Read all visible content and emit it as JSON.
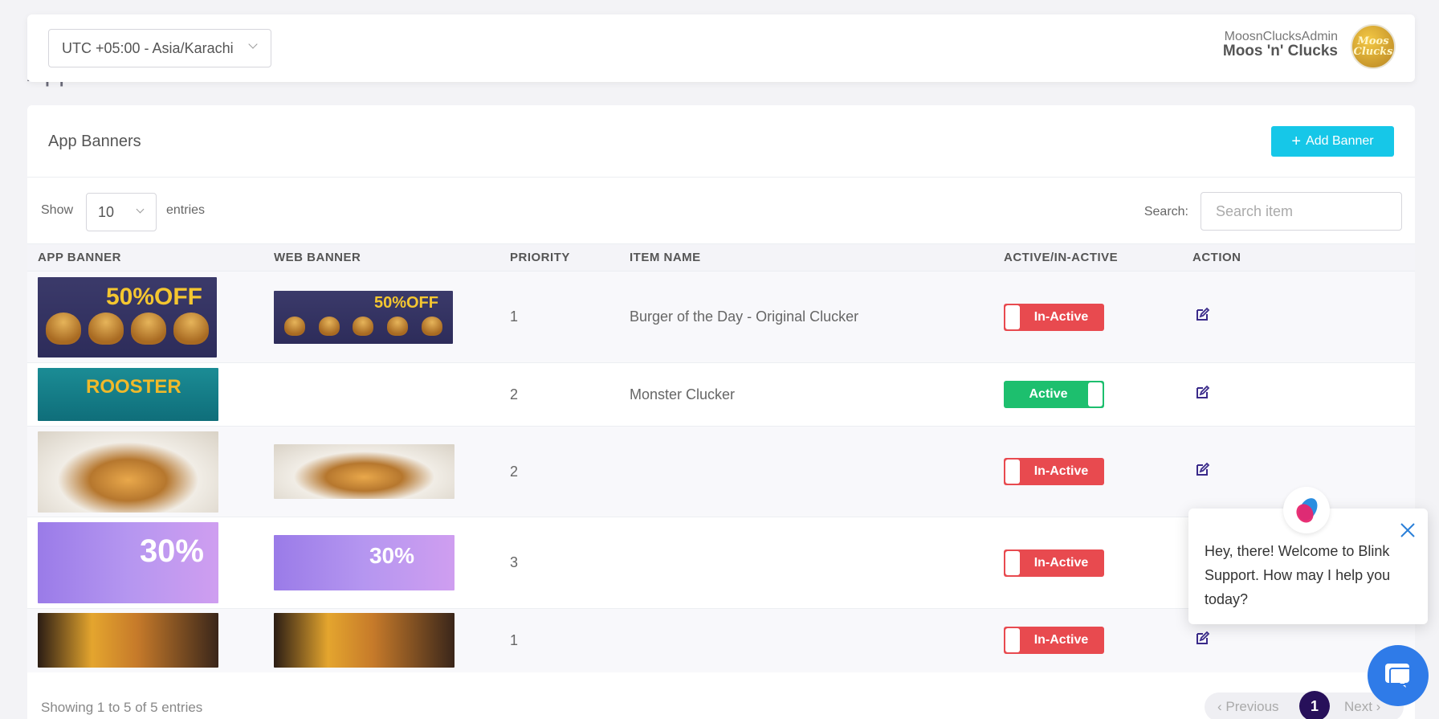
{
  "page": {
    "background_title": "App Banners"
  },
  "topbar": {
    "timezone": "UTC +05:00 - Asia/Karachi",
    "user_id": "MoosnClucksAdmin",
    "user_name": "Moos 'n' Clucks",
    "avatar_text": "Moos Clucks"
  },
  "card": {
    "title": "App Banners",
    "add_button_label": "Add Banner"
  },
  "controls": {
    "show_label": "Show",
    "page_length": "10",
    "entries_label": "entries",
    "search_label": "Search:",
    "search_placeholder": "Search item"
  },
  "table": {
    "columns": [
      "APP BANNER",
      "WEB BANNER",
      "PRIORITY",
      "ITEM NAME",
      "ACTIVE/IN-ACTIVE",
      "ACTION"
    ],
    "rows": [
      {
        "priority": "1",
        "item_name": "Burger of the Day - Original Clucker",
        "status": "In-Active",
        "active": false,
        "app_banner_text": "50%OFF",
        "web_banner_text": "50%OFF"
      },
      {
        "priority": "2",
        "item_name": "Monster Clucker",
        "status": "Active",
        "active": true,
        "app_banner_text": "ROOSTER",
        "web_banner_text": ""
      },
      {
        "priority": "2",
        "item_name": "",
        "status": "In-Active",
        "active": false,
        "app_banner_text": "",
        "web_banner_text": ""
      },
      {
        "priority": "3",
        "item_name": "",
        "status": "In-Active",
        "active": false,
        "app_banner_text": "30%",
        "web_banner_text": "30%"
      },
      {
        "priority": "1",
        "item_name": "",
        "status": "In-Active",
        "active": false,
        "app_banner_text": "",
        "web_banner_text": ""
      }
    ]
  },
  "footer": {
    "info": "Showing 1 to 5 of 5 entries",
    "prev_label": "‹ Previous",
    "current_page": "1",
    "next_label": "Next ›"
  },
  "chat": {
    "message": "Hey, there! Welcome to Blink Support. How may I help you today?"
  },
  "colors": {
    "accent": "#16c7e8",
    "inactive": "#e84a4f",
    "active": "#1dbf6e",
    "page_active": "#27105a",
    "chat": "#2f7be8"
  },
  "icons": [
    "chevron-down-icon",
    "plus-icon",
    "edit-icon",
    "close-icon",
    "chat-icon"
  ]
}
